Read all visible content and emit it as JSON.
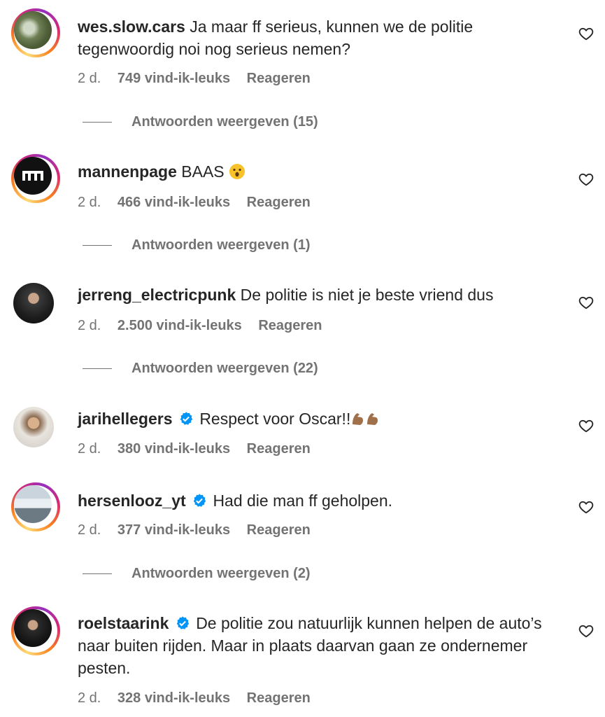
{
  "comments": [
    {
      "username": "wes.slow.cars",
      "verified": false,
      "text": "Ja maar ff serieus, kunnen we de politie tegenwoordig noi nog serieus nemen?",
      "time": "2 d.",
      "likes": "749 vind-ik-leuks",
      "reply": "Reageren",
      "view_replies": "Antwoorden weergeven (15)"
    },
    {
      "username": "mannenpage",
      "verified": false,
      "text": "BAAS",
      "emoji": "astonished-face-emoji",
      "time": "2 d.",
      "likes": "466 vind-ik-leuks",
      "reply": "Reageren",
      "view_replies": "Antwoorden weergeven (1)"
    },
    {
      "username": "jerreng_electricpunk",
      "verified": false,
      "text": "De politie is niet je beste vriend dus",
      "time": "2 d.",
      "likes": "2.500 vind-ik-leuks",
      "reply": "Reageren",
      "view_replies": "Antwoorden weergeven (22)"
    },
    {
      "username": "jarihellegers",
      "verified": true,
      "text": "Respect voor Oscar!!",
      "emoji": "flexed-biceps-emoji",
      "time": "2 d.",
      "likes": "380 vind-ik-leuks",
      "reply": "Reageren"
    },
    {
      "username": "hersenlooz_yt",
      "verified": true,
      "text": "Had die man ff geholpen.",
      "time": "2 d.",
      "likes": "377 vind-ik-leuks",
      "reply": "Reageren",
      "view_replies": "Antwoorden weergeven (2)"
    },
    {
      "username": "roelstaarink",
      "verified": true,
      "text": "De politie zou natuurlijk kunnen helpen de auto’s naar buiten rijden. Maar in plaats daarvan gaan ze ondernemer pesten.",
      "time": "2 d.",
      "likes": "328 vind-ik-leuks",
      "reply": "Reageren"
    }
  ],
  "colors": {
    "text": "#262626",
    "secondary": "#737373",
    "verified": "#0095f6",
    "ring": [
      "#feda75",
      "#fa7e1e",
      "#d62976",
      "#962fbf"
    ]
  }
}
